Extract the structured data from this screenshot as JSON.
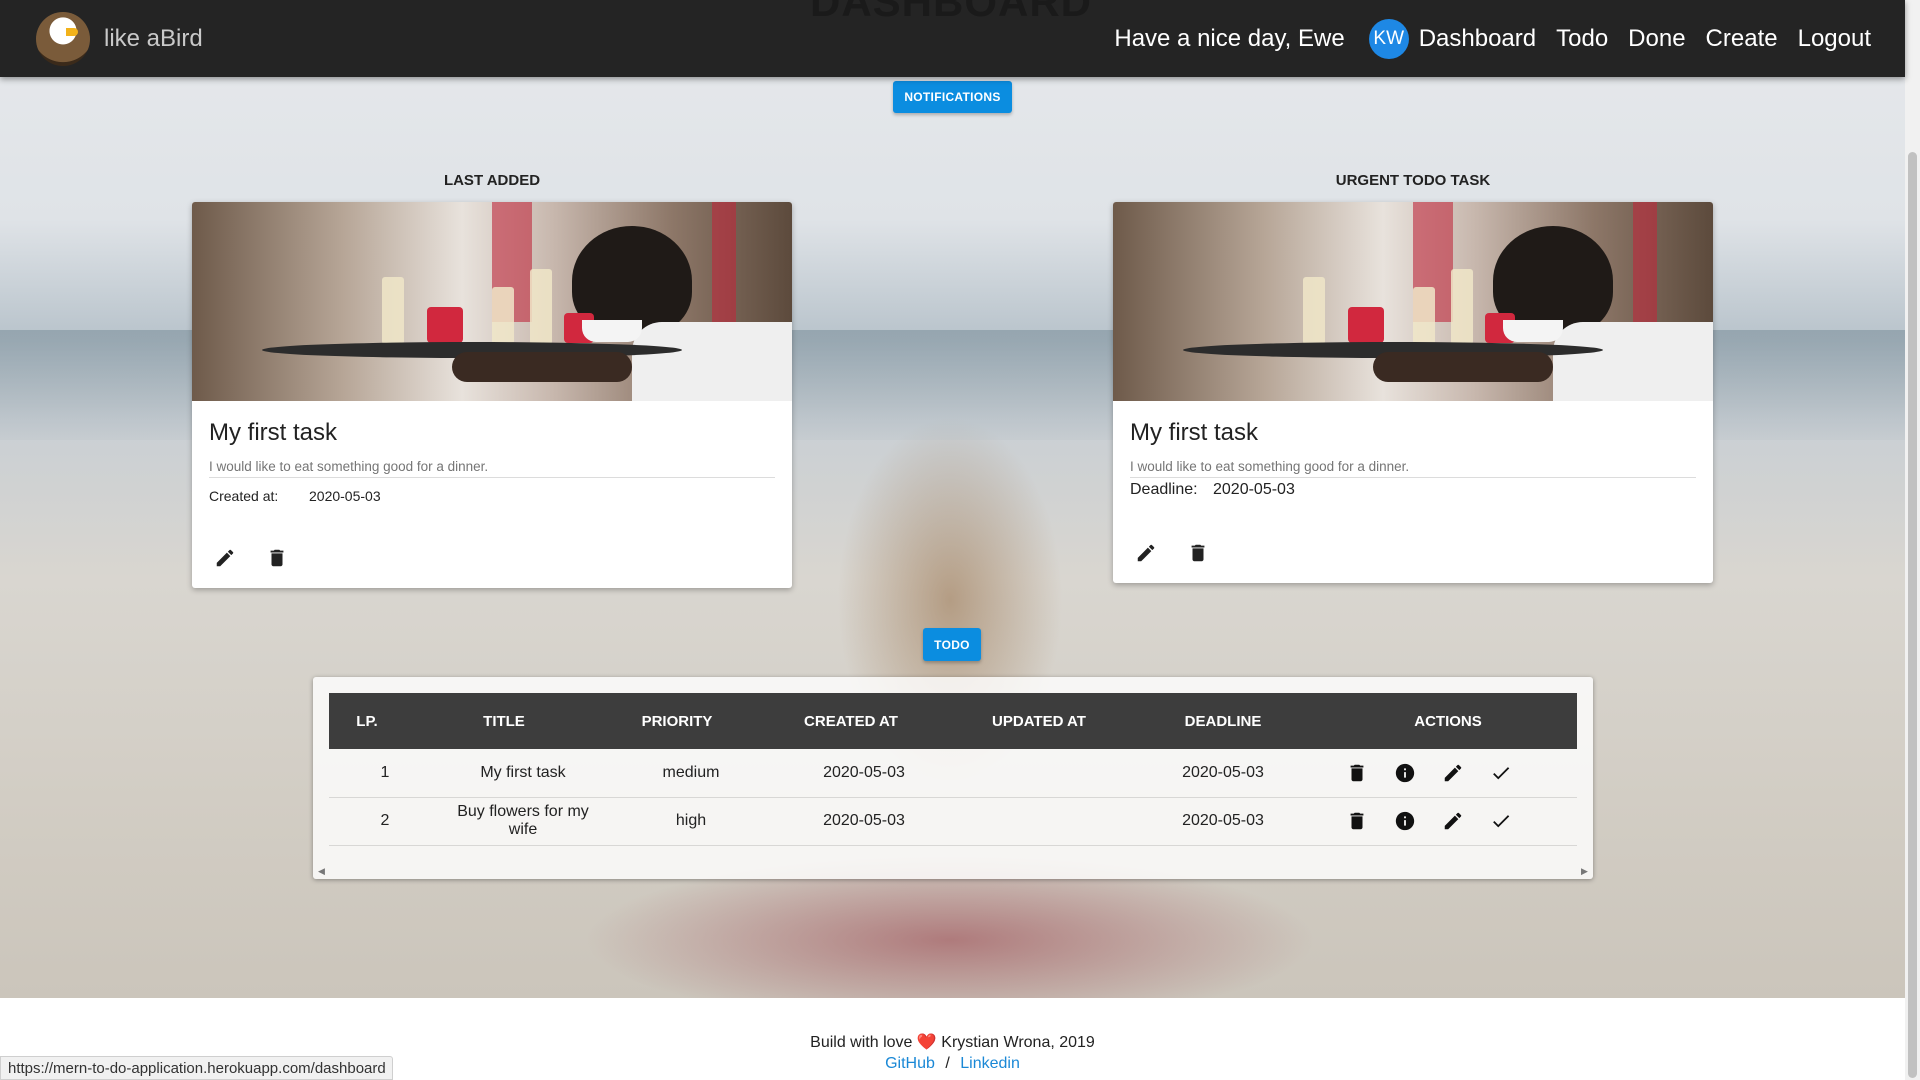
{
  "navbar": {
    "brand_name": "like aBird",
    "page_heading": "DASHBOARD",
    "greeting": "Have a nice day, Ewe",
    "avatar_initials": "KW",
    "links": [
      "Dashboard",
      "Todo",
      "Done",
      "Create",
      "Logout"
    ]
  },
  "buttons": {
    "notifications": "NOTIFICATIONS",
    "todo": "TODO"
  },
  "last_added": {
    "section_label": "LAST ADDED",
    "title": "My first task",
    "description": "I would like to eat something good for a dinner.",
    "meta_key": "Created at:",
    "meta_value": "2020-05-03"
  },
  "urgent": {
    "section_label": "URGENT TODO TASK",
    "title": "My first task",
    "description": "I would like to eat something good for a dinner.",
    "meta_key": "Deadline:",
    "meta_value": "2020-05-03"
  },
  "table": {
    "headers": [
      "LP.",
      "TITLE",
      "PRIORITY",
      "CREATED AT",
      "UPDATED AT",
      "DEADLINE",
      "ACTIONS"
    ],
    "rows": [
      {
        "lp": "1",
        "title": "My first task",
        "priority": "medium",
        "created": "2020-05-03",
        "updated": "",
        "deadline": "2020-05-03"
      },
      {
        "lp": "2",
        "title": "Buy flowers for my wife",
        "priority": "high",
        "created": "2020-05-03",
        "updated": "",
        "deadline": "2020-05-03"
      }
    ]
  },
  "footer": {
    "line_before": "Build with love",
    "line_after": "Krystian Wrona, 2019",
    "github": "GitHub",
    "separator": "/",
    "linkedin": "Linkedin"
  },
  "status_url": "https://mern-to-do-application.herokuapp.com/dashboard",
  "colors": {
    "accent": "#0b8de0",
    "navbar": "#242424",
    "table_header": "#3d3d3d",
    "link": "#1a88d6",
    "heart": "#e53935"
  }
}
